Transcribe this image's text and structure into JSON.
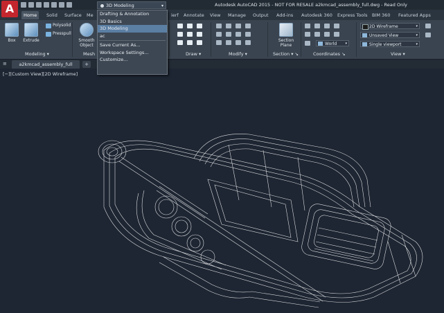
{
  "titlebar": {
    "logo_letter": "A",
    "workspace_current": "3D Modeling",
    "window_title": "Autodesk AutoCAD 2015 - NOT FOR RESALE   a2kmcad_assembly_full.dwg - Read Only"
  },
  "tabs": [
    {
      "label": "Home",
      "active": true
    },
    {
      "label": "Solid"
    },
    {
      "label": "Surface"
    },
    {
      "label": "Me"
    },
    {
      "label": "ierf"
    },
    {
      "label": "Annotate"
    },
    {
      "label": "View"
    },
    {
      "label": "Manage"
    },
    {
      "label": "Output"
    },
    {
      "label": "Add-ins"
    },
    {
      "label": "Autodesk 360"
    },
    {
      "label": "Express Tools"
    },
    {
      "label": "BIM 360"
    },
    {
      "label": "Featured Apps"
    }
  ],
  "ribbon": {
    "box_label": "Box",
    "extrude_label": "Extrude",
    "polysolid_label": "Polysolid",
    "presspull_label": "Presspull",
    "smooth_label_1": "Smooth",
    "smooth_label_2": "Object",
    "section_plane_1": "Section",
    "section_plane_2": "Plane",
    "world_label": "World",
    "visual_style": "2D Wireframe",
    "saved_view": "Unsaved View",
    "viewport_config": "Single viewport",
    "panels": {
      "modeling": "Modeling ▾",
      "mesh": "Mesh",
      "draw": "Draw ▾",
      "modify": "Modify ▾",
      "section": "Section ▾ ↘",
      "coordinates": "Coordinates ↘",
      "view": "View ▾"
    }
  },
  "workspace_menu": {
    "items": [
      {
        "label": "Drafting & Annotation"
      },
      {
        "label": "3D Basics"
      },
      {
        "label": "3D Modeling",
        "selected": true
      },
      {
        "label": "ac"
      }
    ],
    "actions": [
      {
        "label": "Save Current As..."
      },
      {
        "label": "Workspace Settings..."
      },
      {
        "label": "Customize..."
      }
    ]
  },
  "file_tab": {
    "name": "a2kmcad_assembly_full",
    "new_tab": "+"
  },
  "viewport": {
    "label": "[−][Custom View][2D Wireframe]"
  },
  "colors": {
    "accent_red": "#c4262e",
    "viewport_bg": "#1e2633",
    "wire": "#ffffff",
    "selected_menu": "#5b7ea3"
  }
}
